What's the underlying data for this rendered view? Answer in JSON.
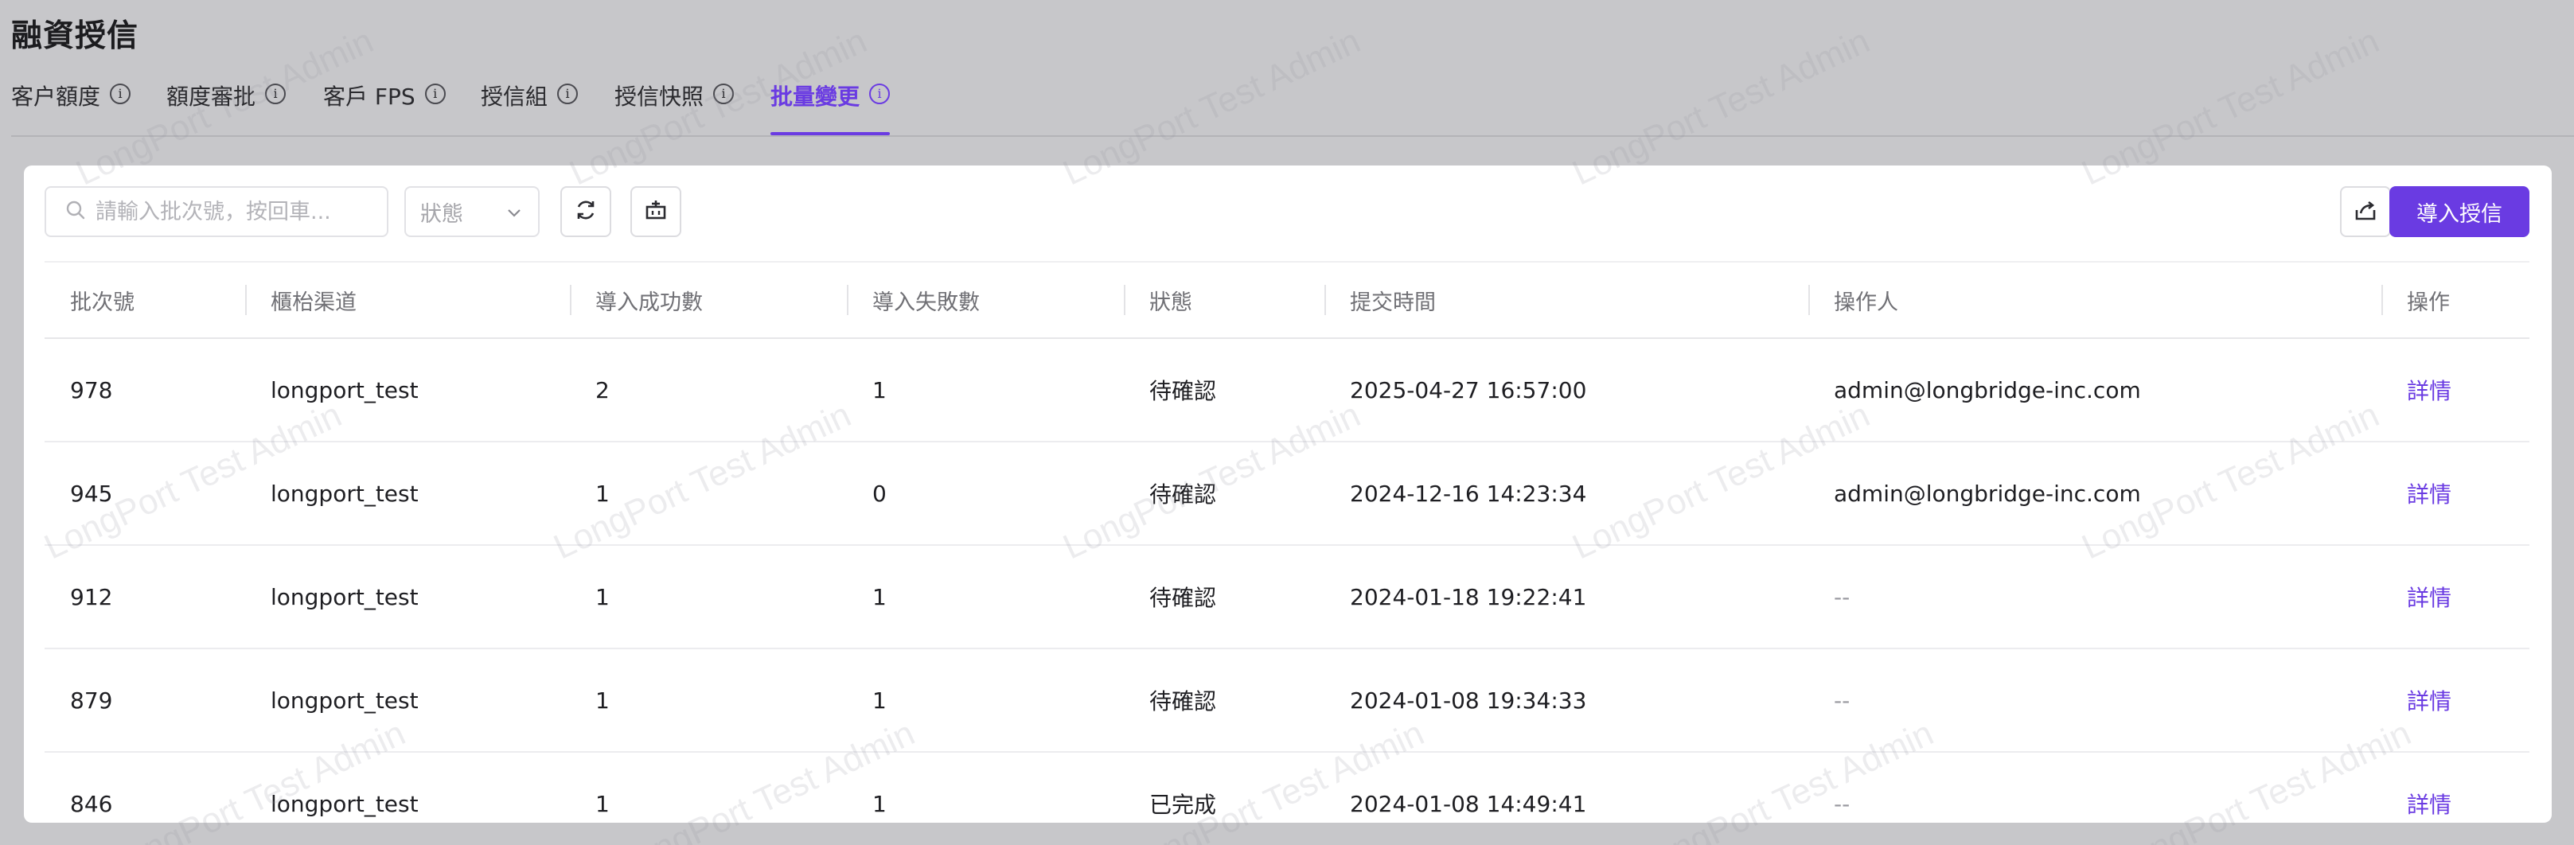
{
  "page": {
    "title": "融資授信"
  },
  "tabs": [
    {
      "label": "客户額度",
      "active": false
    },
    {
      "label": "額度審批",
      "active": false
    },
    {
      "label": "客戶 FPS",
      "active": false
    },
    {
      "label": "授信組",
      "active": false
    },
    {
      "label": "授信快照",
      "active": false
    },
    {
      "label": "批量變更",
      "active": true
    }
  ],
  "toolbar": {
    "search_placeholder": "請輸入批次號，按回車...",
    "status_placeholder": "狀態",
    "import_label": "導入授信"
  },
  "table": {
    "headers": [
      "批次號",
      "櫃枱渠道",
      "導入成功數",
      "導入失敗數",
      "狀態",
      "提交時間",
      "操作人",
      "操作"
    ],
    "rows": [
      {
        "batch": "978",
        "channel": "longport_test",
        "success": "2",
        "failed": "1",
        "status": "待確認",
        "submitted": "2025-04-27 16:57:00",
        "operator": "admin@longbridge-inc.com",
        "action": "詳情"
      },
      {
        "batch": "945",
        "channel": "longport_test",
        "success": "1",
        "failed": "0",
        "status": "待確認",
        "submitted": "2024-12-16 14:23:34",
        "operator": "admin@longbridge-inc.com",
        "action": "詳情"
      },
      {
        "batch": "912",
        "channel": "longport_test",
        "success": "1",
        "failed": "1",
        "status": "待確認",
        "submitted": "2024-01-18 19:22:41",
        "operator": "--",
        "action": "詳情"
      },
      {
        "batch": "879",
        "channel": "longport_test",
        "success": "1",
        "failed": "1",
        "status": "待確認",
        "submitted": "2024-01-08 19:34:33",
        "operator": "--",
        "action": "詳情"
      },
      {
        "batch": "846",
        "channel": "longport_test",
        "success": "1",
        "failed": "1",
        "status": "已完成",
        "submitted": "2024-01-08 14:49:41",
        "operator": "--",
        "action": "詳情"
      }
    ]
  },
  "watermark": {
    "text": "LongPort Test Admin"
  },
  "colors": {
    "accent": "#6a3be2",
    "overlay": "#c7c7ca"
  }
}
